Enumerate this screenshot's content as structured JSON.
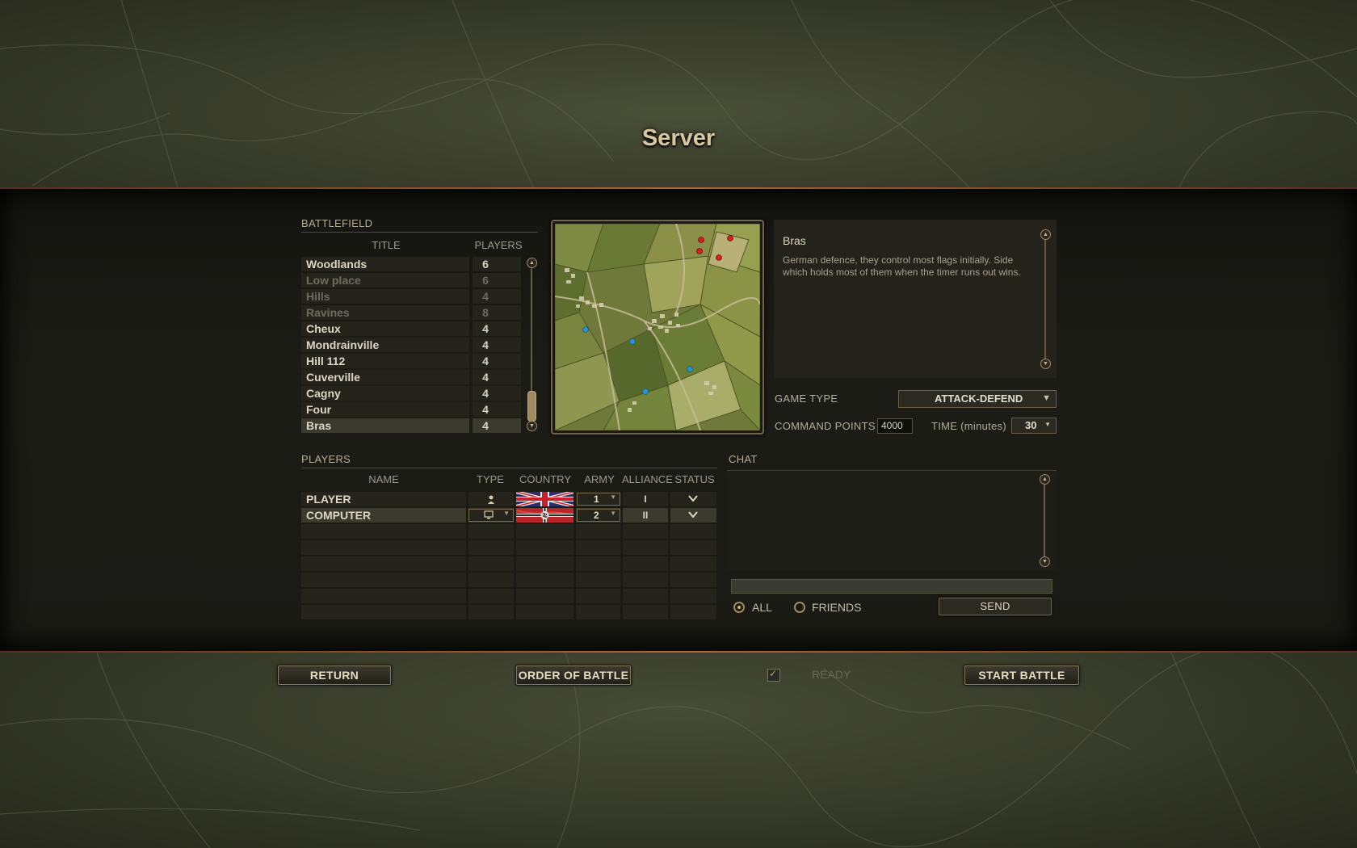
{
  "page": {
    "title": "Server"
  },
  "battlefield": {
    "label": "BATTLEFIELD",
    "col_title": "TITLE",
    "col_players": "PLAYERS",
    "maps": [
      {
        "title": "Woodlands",
        "players": "6",
        "available": true
      },
      {
        "title": "Low place",
        "players": "6",
        "available": false
      },
      {
        "title": "Hills",
        "players": "4",
        "available": false
      },
      {
        "title": "Ravines",
        "players": "8",
        "available": false
      },
      {
        "title": "Cheux",
        "players": "4",
        "available": true
      },
      {
        "title": "Mondrainville",
        "players": "4",
        "available": true
      },
      {
        "title": "Hill 112",
        "players": "4",
        "available": true
      },
      {
        "title": "Cuverville",
        "players": "4",
        "available": true
      },
      {
        "title": "Cagny",
        "players": "4",
        "available": true
      },
      {
        "title": "Four",
        "players": "4",
        "available": true
      },
      {
        "title": "Bras",
        "players": "4",
        "available": true,
        "selected": true
      }
    ]
  },
  "description": {
    "title": "Bras",
    "text": "German defence, they control most flags initially. Side which holds most of them when the timer runs out wins."
  },
  "settings": {
    "game_type_label": "GAME TYPE",
    "game_type_value": "ATTACK-DEFEND",
    "command_points_label": "COMMAND POINTS",
    "command_points_value": "4000",
    "time_label": "TIME (minutes)",
    "time_value": "30"
  },
  "players": {
    "label": "PLAYERS",
    "columns": [
      "NAME",
      "TYPE",
      "COUNTRY",
      "ARMY",
      "ALLIANCE",
      "STATUS"
    ],
    "rows": [
      {
        "name": "PLAYER",
        "type": "human-icon",
        "country": "United Kingdom",
        "army": "1",
        "alliance": "I",
        "status": "chevron-down-icon"
      },
      {
        "name": "COMPUTER",
        "type": "computer-icon",
        "country": "Germany",
        "army": "2",
        "alliance": "II",
        "status": "chevron-down-icon"
      }
    ]
  },
  "chat": {
    "label": "CHAT",
    "radio_all": "ALL",
    "radio_friends": "FRIENDS",
    "send_label": "SEND"
  },
  "footer": {
    "return_label": "RETURN",
    "order_label": "ORDER OF BATTLE",
    "ready_label": "READY",
    "start_label": "START BATTLE"
  },
  "colors": {
    "accent": "#b0683a",
    "red_marker": "#d81e1e",
    "blue_marker": "#2a8ee0"
  }
}
